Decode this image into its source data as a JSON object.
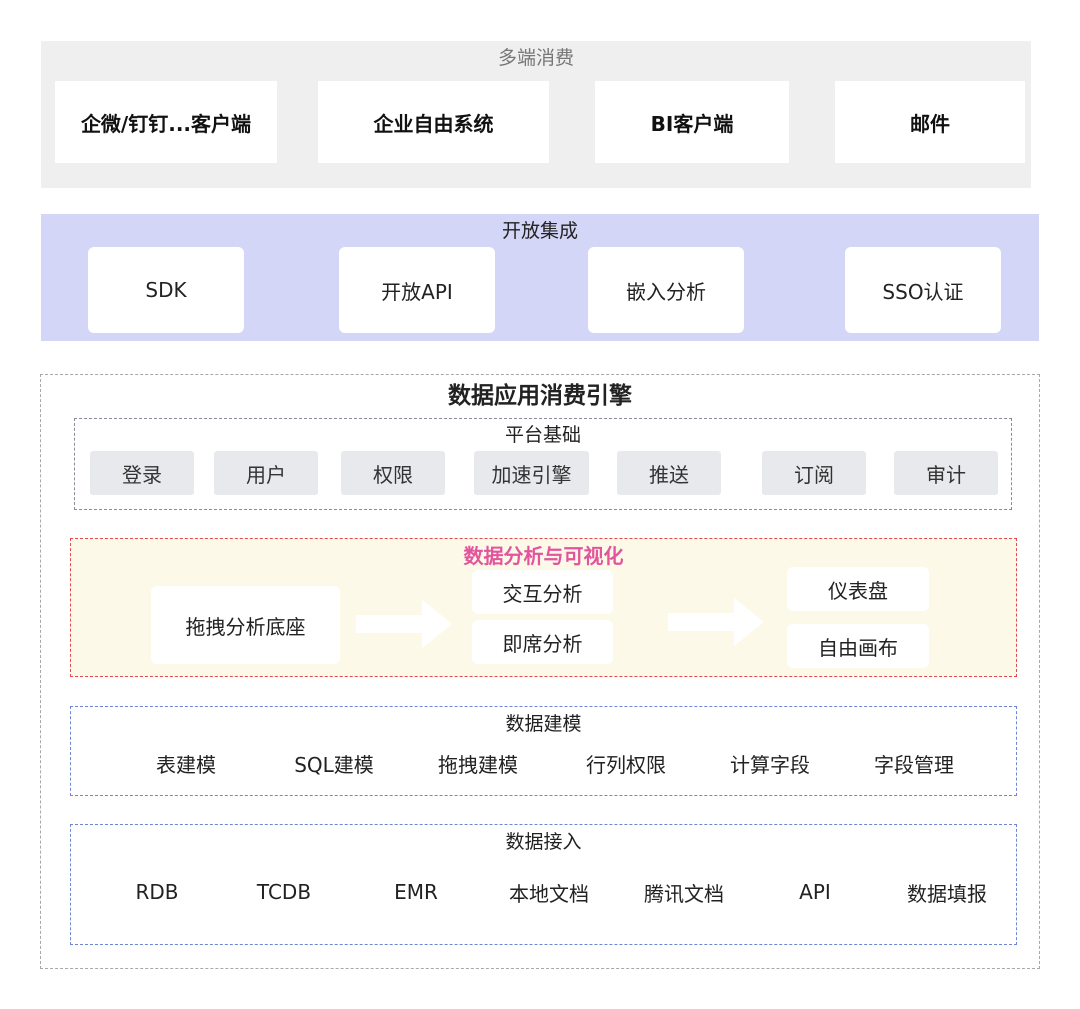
{
  "consumption": {
    "title": "多端消费",
    "items": [
      "企微/钉钉...客户端",
      "企业自由系统",
      "BI客户端",
      "邮件"
    ]
  },
  "integration": {
    "title": "开放集成",
    "items": [
      "SDK",
      "开放API",
      "嵌入分析",
      "SSO认证"
    ]
  },
  "engine": {
    "title": "数据应用消费引擎",
    "platform": {
      "title": "平台基础",
      "items": [
        "登录",
        "用户",
        "权限",
        "加速引擎",
        "推送",
        "订阅",
        "审计"
      ]
    },
    "analysis": {
      "title": "数据分析与可视化",
      "base": "拖拽分析底座",
      "middle": [
        "交互分析",
        "即席分析"
      ],
      "right": [
        "仪表盘",
        "自由画布"
      ]
    },
    "modeling": {
      "title": "数据建模",
      "items": [
        "表建模",
        "SQL建模",
        "拖拽建模",
        "行列权限",
        "计算字段",
        "字段管理"
      ]
    },
    "access": {
      "title": "数据接入",
      "items": [
        "RDB",
        "TCDB",
        "EMR",
        "本地文档",
        "腾讯文档",
        "API",
        "数据填报"
      ]
    }
  },
  "colors": {
    "consumption_bg": "#efefef",
    "integration_bg": "#d4d6f7",
    "analysis_bg": "#fcf9e9",
    "analysis_border": "#e04a52",
    "analysis_title": "#e2559c",
    "model_border": "#6f86d6"
  }
}
